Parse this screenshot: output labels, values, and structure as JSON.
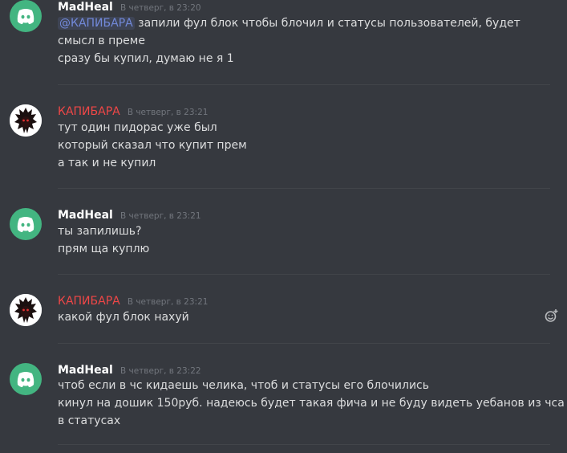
{
  "messages": [
    {
      "author": "MadHeal",
      "timestamp": "В четверг, в 23:20",
      "mention": "@КАПИБАРА",
      "lines": [
        "запили фул блок чтобы блочил и статусы пользователей, будет",
        "смысл в преме",
        "сразу бы купил, думаю не я 1"
      ]
    },
    {
      "author": "КАПИБАРА",
      "timestamp": "В четверг, в 23:21",
      "lines": [
        "тут один пидорас уже был",
        "который сказал что купит прем",
        "а так и не купил"
      ]
    },
    {
      "author": "MadHeal",
      "timestamp": "В четверг, в 23:21",
      "lines": [
        "ты запилишь?",
        "прям ща куплю"
      ]
    },
    {
      "author": "КАПИБАРА",
      "timestamp": "В четверг, в 23:21",
      "lines": [
        "какой фул блок нахуй"
      ]
    },
    {
      "author": "MadHeal",
      "timestamp": "В четверг, в 23:22",
      "lines": [
        "чтоб если в чс кидаешь челика, чтоб и статусы его блочились",
        "кинул на дошик 150руб. надеюсь будет такая фича и не буду видеть уебанов из чса",
        "в статусах"
      ]
    }
  ],
  "icons": {
    "discord_avatar": "discord-logo-icon",
    "kapibara_avatar": "dark-creature-avatar-icon",
    "add_reaction": "add-reaction-icon"
  },
  "colors": {
    "background": "#36393f",
    "author_default": "#ffffff",
    "author_red": "#f04747",
    "text": "#dcddde",
    "timestamp": "#72767d",
    "mention": "#7289da",
    "discord_green": "#43b581"
  }
}
